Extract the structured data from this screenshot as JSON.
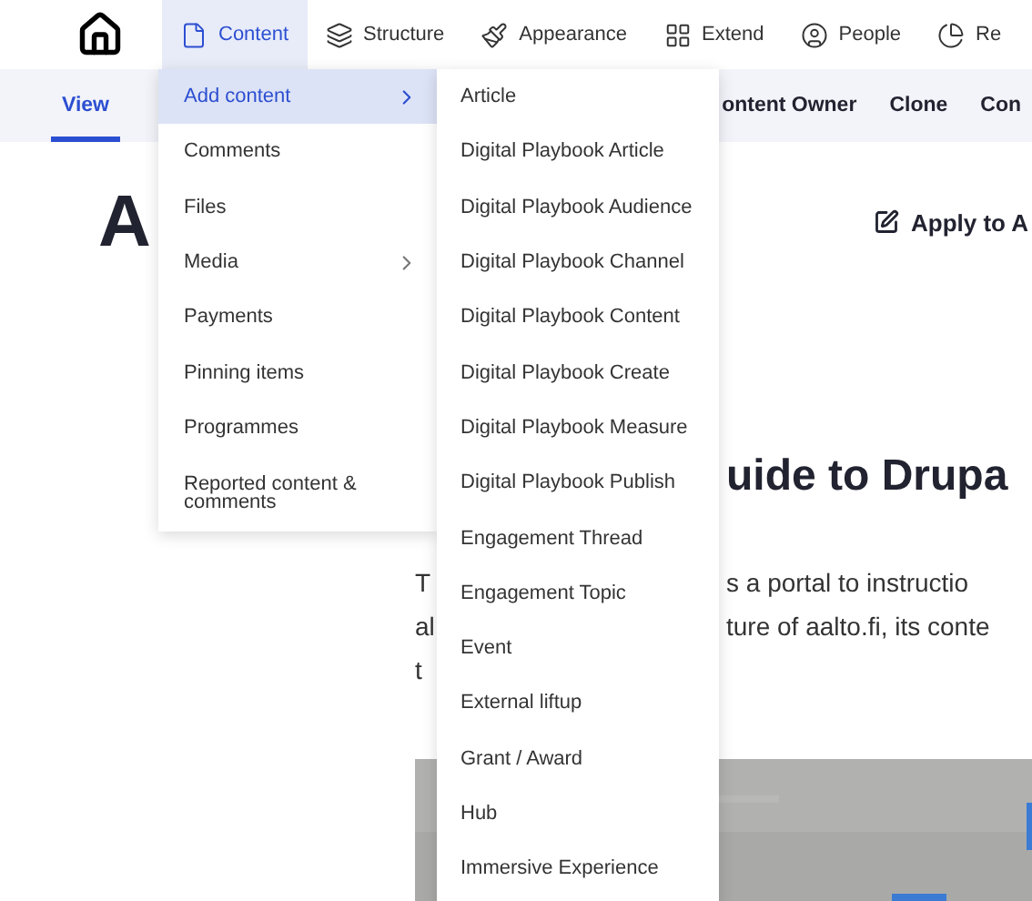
{
  "toolbar": {
    "items": [
      {
        "label": "Content",
        "selected": true
      },
      {
        "label": "Structure",
        "selected": false
      },
      {
        "label": "Appearance",
        "selected": false
      },
      {
        "label": "Extend",
        "selected": false
      },
      {
        "label": "People",
        "selected": false
      },
      {
        "label": "Re",
        "selected": false
      }
    ]
  },
  "tabs": [
    {
      "label": "View",
      "selected": true
    },
    {
      "label": "ontent Owner",
      "selected": false
    },
    {
      "label": "Clone",
      "selected": false
    },
    {
      "label": "Con",
      "selected": false
    }
  ],
  "page": {
    "title_fragment": "A",
    "action": "Apply to A",
    "heading_fragment": "uide to Drupa",
    "paragraph_left": [
      "T",
      "al",
      "t"
    ],
    "paragraph_right": [
      "s a portal to instructio",
      "ture of aalto.fi, its conte"
    ]
  },
  "content_menu": {
    "items": [
      {
        "label": "Add content",
        "selected": true,
        "submenu": true
      },
      {
        "label": "Comments",
        "selected": false,
        "submenu": false
      },
      {
        "label": "Files",
        "selected": false,
        "submenu": false
      },
      {
        "label": "Media",
        "selected": false,
        "submenu": true
      },
      {
        "label": "Payments",
        "selected": false,
        "submenu": false
      },
      {
        "label": "Pinning items",
        "selected": false,
        "submenu": false
      },
      {
        "label": "Programmes",
        "selected": false,
        "submenu": false
      },
      {
        "label": "Reported content & comments",
        "selected": false,
        "submenu": false
      }
    ]
  },
  "add_content_menu": {
    "items": [
      "Article",
      "Digital Playbook Article",
      "Digital Playbook Audience",
      "Digital Playbook Channel",
      "Digital Playbook Content",
      "Digital Playbook Create",
      "Digital Playbook Measure",
      "Digital Playbook Publish",
      "Engagement Thread",
      "Engagement Topic",
      "Event",
      "External liftup",
      "Grant / Award",
      "Hub",
      "Immersive Experience"
    ]
  }
}
